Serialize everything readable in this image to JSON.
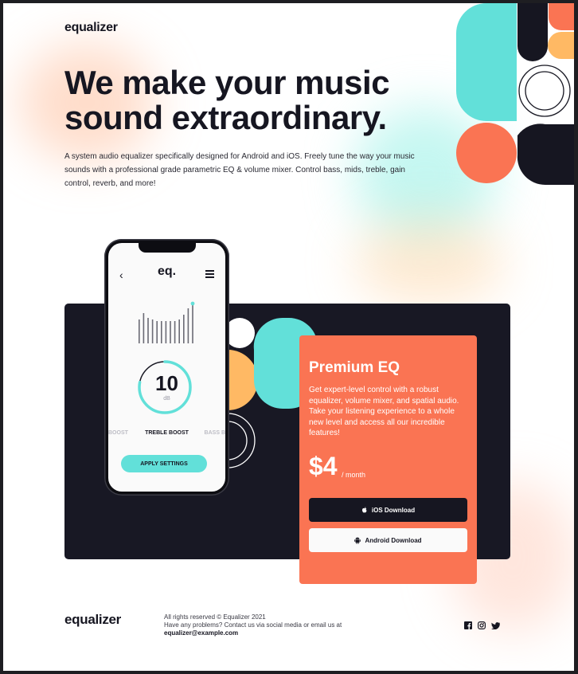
{
  "header": {
    "brand": "equalizer"
  },
  "hero": {
    "title": "We make your music sound extraordinary.",
    "description": "A system audio equalizer specifically designed for Android and iOS. Freely tune the way your music sounds with a professional grade parametric EQ & volume mixer. Control bass, mids, treble, gain control, reverb, and more!"
  },
  "phone": {
    "logo": "eq.",
    "back_icon": "chevron-left-icon",
    "menu_icon": "hamburger-menu-icon",
    "dial_value": "10",
    "dial_unit": "dB",
    "dial_fill": 0.78,
    "modes": {
      "prev": "BOOST",
      "current": "TREBLE BOOST",
      "next": "BASS B"
    },
    "apply_label": "APPLY SETTINGS"
  },
  "premium": {
    "title": "Premium EQ",
    "description": "Get expert-level control with a robust equalizer, volume mixer, and spatial audio. Take your listening experience to a whole new level and access all our incredible features!",
    "price": "$4",
    "price_unit": "/ month",
    "ios_label": "iOS Download",
    "android_label": "Android Download",
    "ios_icon": "apple-icon",
    "android_icon": "android-icon"
  },
  "footer": {
    "brand": "equalizer",
    "rights": "All rights reserved © Equalizer 2021",
    "contact": "Have any problems? Contact us via social media or email us at",
    "email": "equalizer@example.com",
    "social_icons": [
      "facebook-icon",
      "instagram-icon",
      "twitter-icon"
    ]
  },
  "colors": {
    "dark": "#161621",
    "orange": "#fa7453",
    "teal": "#62e0d9",
    "yellow": "#ffb964",
    "background": "#ffffff"
  }
}
